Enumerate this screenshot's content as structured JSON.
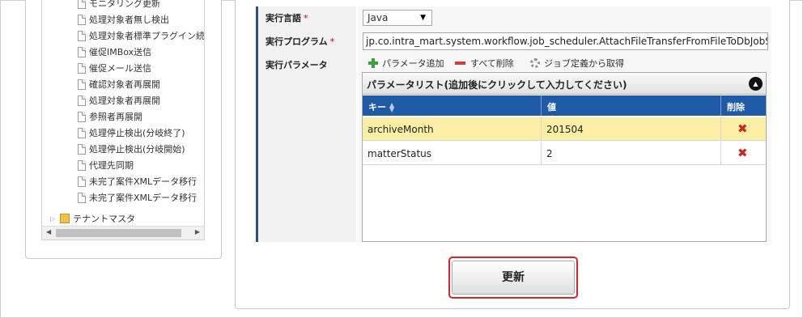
{
  "tree": {
    "items": [
      "モニタリング更新",
      "処理対象者無し検出",
      "処理対象者標準プラグイン続",
      "催促IMBox送信",
      "催促メール送信",
      "確認対象者再展開",
      "処理対象者再展開",
      "参照者再展開",
      "処理停止検出(分岐終了)",
      "処理停止検出(分岐開始)",
      "代理先同期",
      "未完了案件XMLデータ移行",
      "未完了案件XMLデータ移行"
    ],
    "folder": "テナントマスタ"
  },
  "form": {
    "language_label": "実行言語",
    "language_value": "Java",
    "program_label": "実行プログラム",
    "program_value": "jp.co.intra_mart.system.workflow.job_scheduler.AttachFileTransferFromFileToDbJobS",
    "params_label": "実行パラメータ",
    "required_mark": "*"
  },
  "toolbar": {
    "add_label": "パラメータ追加",
    "delete_all_label": "すべて削除",
    "fetch_label": "ジョブ定義から取得"
  },
  "param_list": {
    "title": "パラメータリスト(追加後にクリックして入力してください)",
    "columns": [
      "キー",
      "値",
      "削除"
    ],
    "rows": [
      {
        "key": "archiveMonth",
        "value": "201504",
        "delete": "✖"
      },
      {
        "key": "matterStatus",
        "value": "2",
        "delete": "✖"
      }
    ]
  },
  "actions": {
    "update_label": "更新"
  }
}
